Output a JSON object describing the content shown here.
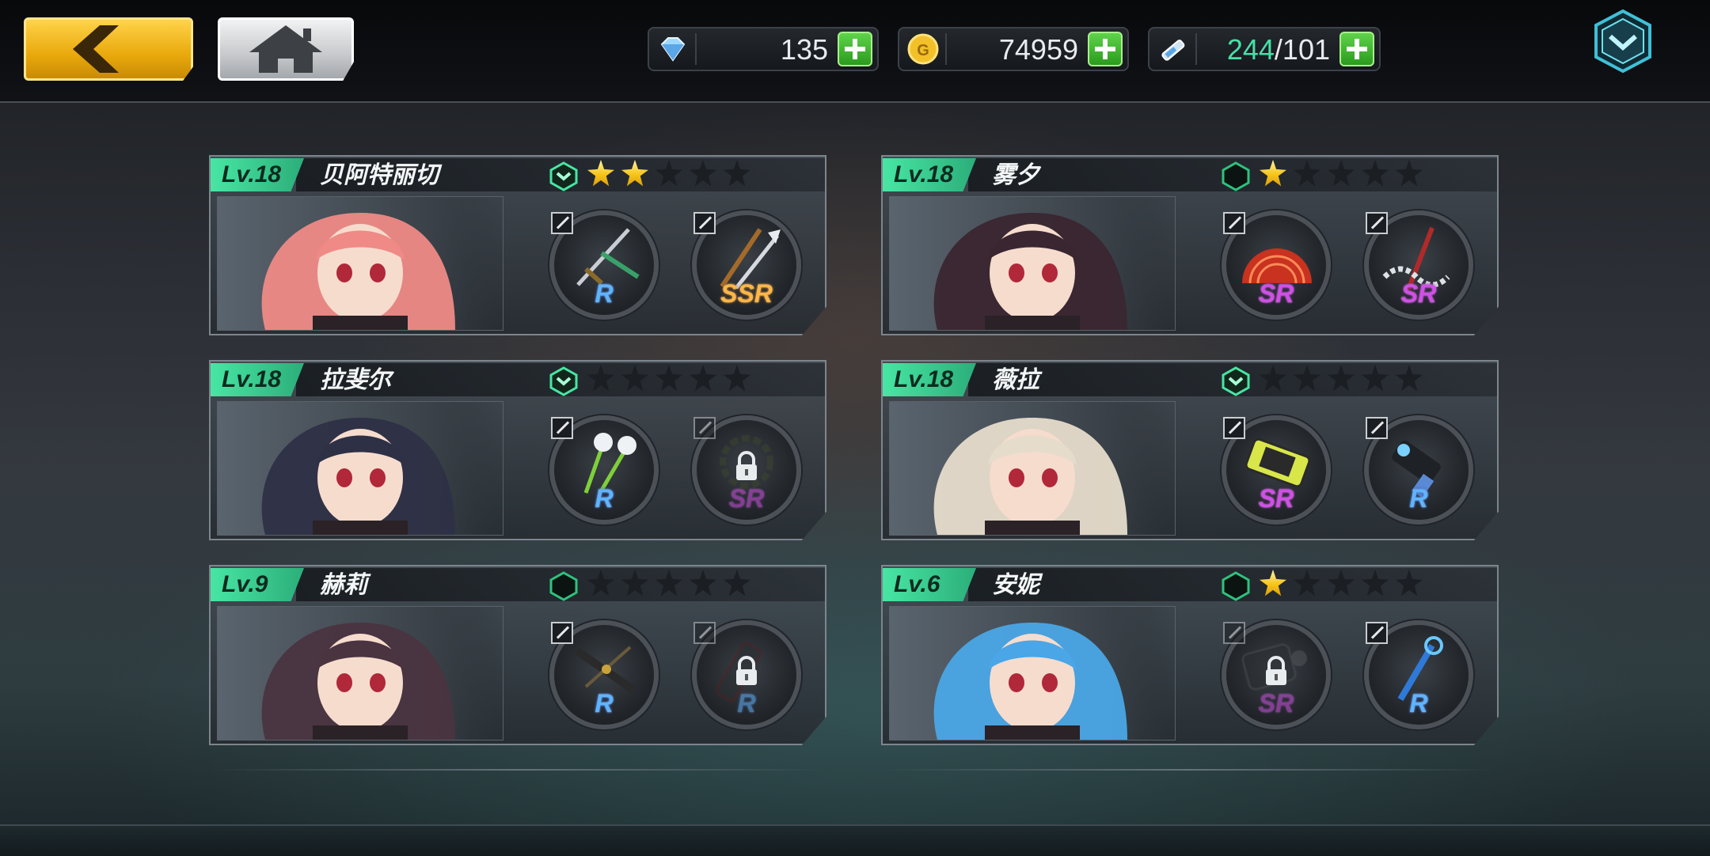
{
  "header": {
    "back_icon": "chevron-left-icon",
    "home_icon": "home-icon",
    "diamonds": {
      "icon": "diamond-icon",
      "value": "135"
    },
    "gold": {
      "icon": "gold-coin-icon",
      "value": "74959"
    },
    "stamina": {
      "icon": "stamina-syringe-icon",
      "current": "244",
      "separator": "/",
      "max": "101"
    },
    "menu_icon": "chevron-down-hex-icon"
  },
  "colors": {
    "level": "#47e6a3",
    "star_on": "#f7c51a",
    "rarity_r": "#5fb4ff",
    "rarity_sr": "#d050e6",
    "rarity_ssr": "#ffb648"
  },
  "characters": [
    {
      "level": "Lv.18",
      "name": "贝阿特丽切",
      "rank_upgradable": true,
      "stars": 2,
      "hair": "#ef8a86",
      "weapons": [
        {
          "rarity": "R",
          "locked": false,
          "art": "sword-icon"
        },
        {
          "rarity": "SSR",
          "locked": false,
          "art": "blades-icon"
        }
      ]
    },
    {
      "level": "Lv.18",
      "name": "雾夕",
      "rank_upgradable": false,
      "stars": 1,
      "hair": "#3a2630",
      "weapons": [
        {
          "rarity": "SR",
          "locked": false,
          "art": "fan-icon"
        },
        {
          "rarity": "SR",
          "locked": false,
          "art": "chain-blade-icon"
        }
      ]
    },
    {
      "level": "Lv.18",
      "name": "拉斐尔",
      "rank_upgradable": true,
      "stars": 0,
      "hair": "#2e3046",
      "weapons": [
        {
          "rarity": "R",
          "locked": false,
          "art": "flower-wands-icon"
        },
        {
          "rarity": "SR",
          "locked": true,
          "art": "thorn-ring-icon"
        }
      ]
    },
    {
      "level": "Lv.18",
      "name": "薇拉",
      "rank_upgradable": true,
      "stars": 0,
      "hair": "#e6dccb",
      "weapons": [
        {
          "rarity": "SR",
          "locked": false,
          "art": "death-cannon-icon"
        },
        {
          "rarity": "R",
          "locked": false,
          "art": "blaster-icon"
        }
      ]
    },
    {
      "level": "Lv.9",
      "name": "赫莉",
      "rank_upgradable": false,
      "stars": 0,
      "hair": "#4a3440",
      "weapons": [
        {
          "rarity": "R",
          "locked": false,
          "art": "crossbow-icon"
        },
        {
          "rarity": "R",
          "locked": true,
          "art": "chainsaw-icon"
        }
      ]
    },
    {
      "level": "Lv.6",
      "name": "安妮",
      "rank_upgradable": false,
      "stars": 1,
      "hair": "#4aa6e6",
      "weapons": [
        {
          "rarity": "SR",
          "locked": true,
          "art": "gauntlet-icon"
        },
        {
          "rarity": "R",
          "locked": false,
          "art": "staff-icon"
        }
      ]
    }
  ]
}
